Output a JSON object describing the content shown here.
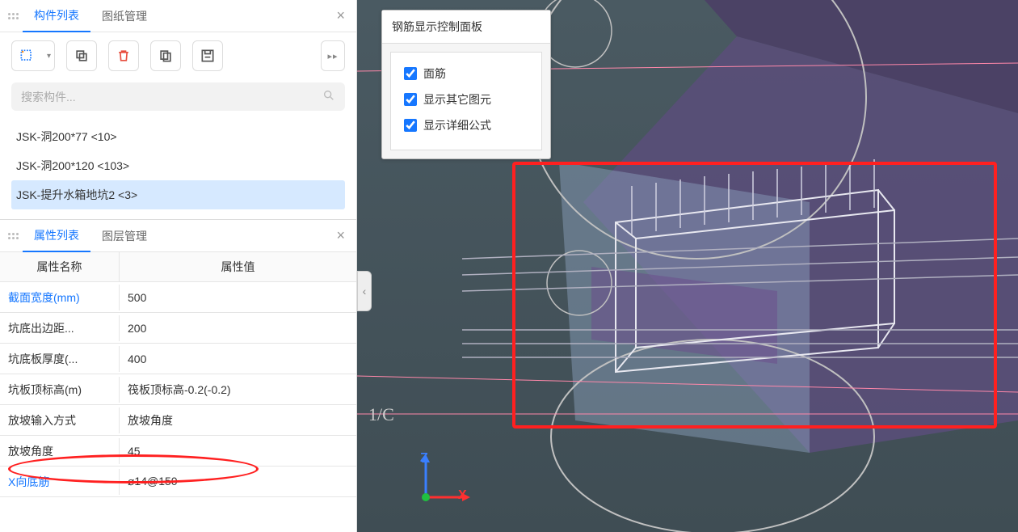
{
  "topTabs": {
    "components": "构件列表",
    "drawings": "图纸管理"
  },
  "search": {
    "placeholder": "搜索构件...",
    "value": ""
  },
  "components": {
    "item0": "JSK-洞200*77 <10>",
    "item1": "JSK-洞200*120 <103>",
    "item2": "JSK-提升水箱地坑2 <3>"
  },
  "bottomTabs": {
    "props": "属性列表",
    "layers": "图层管理"
  },
  "propHeader": {
    "name": "属性名称",
    "value": "属性值"
  },
  "props": {
    "r0": {
      "name": "截面宽度(mm)",
      "value": "500",
      "link": true
    },
    "r1": {
      "name": "坑底出边距...",
      "value": "200"
    },
    "r2": {
      "name": "坑底板厚度(...",
      "value": "400"
    },
    "r3": {
      "name": "坑板顶标高(m)",
      "value": "筏板顶标高-0.2(-0.2)"
    },
    "r4": {
      "name": "放坡输入方式",
      "value": "放坡角度"
    },
    "r5": {
      "name": "放坡角度",
      "value": "45"
    },
    "r6": {
      "name": "X向底筋",
      "value": "⌀14@150",
      "link": true
    }
  },
  "controlPanel": {
    "title": "钢筋显示控制面板",
    "opt0": "面筋",
    "opt1": "显示其它图元",
    "opt2": "显示详细公式"
  },
  "axisLabel": "1/C",
  "axisX": "X",
  "axisZ": "Z"
}
